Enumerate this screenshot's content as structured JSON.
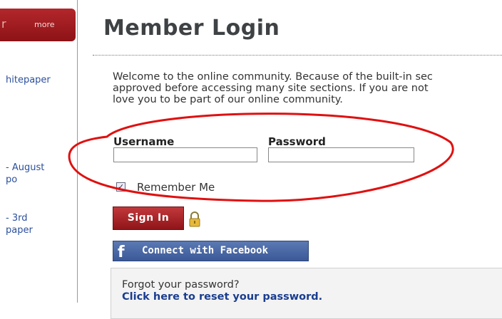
{
  "sidebar": {
    "more_label": "more",
    "links": [
      {
        "line1": "hitepaper",
        "line2": ""
      },
      {
        "line1": "- August",
        "line2": "po"
      },
      {
        "line1": "- 3rd",
        "line2": "paper"
      }
    ]
  },
  "page": {
    "title": "Member Login",
    "welcome_lines": [
      "Welcome to the online community. Because of the built-in sec",
      "approved before accessing many site sections. If you are not",
      "love you to be part of our online community."
    ]
  },
  "form": {
    "username_label": "Username",
    "password_label": "Password",
    "username_value": "",
    "password_value": "",
    "remember_label": "Remember Me",
    "remember_checked": true,
    "signin_label": "Sign In",
    "facebook_label": "Connect with Facebook"
  },
  "forgot": {
    "question": "Forgot your password?",
    "link": "Click here to reset your password."
  },
  "colors": {
    "accent_red": "#a51d21",
    "facebook_blue": "#3b5998",
    "link_blue": "#1a3d8f",
    "annotation_red": "#e01010"
  },
  "icons": [
    "lock-icon",
    "facebook-icon",
    "checkbox-check-icon"
  ]
}
